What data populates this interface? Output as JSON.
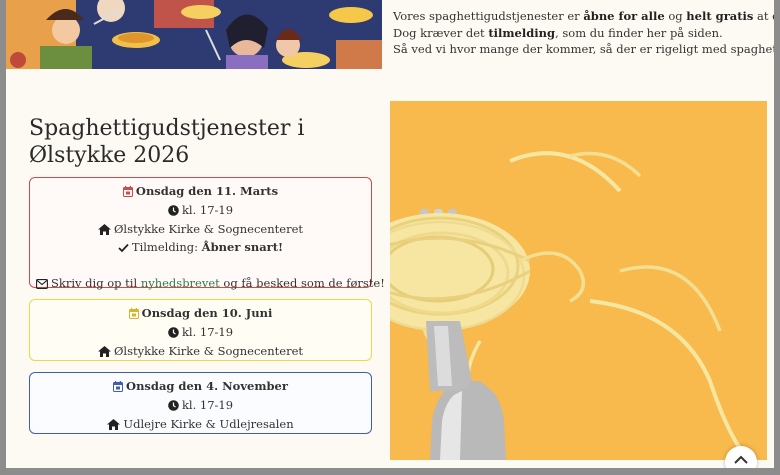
{
  "intro": {
    "line1_pre": "Vores spaghettigudstjenester er ",
    "line1_bold1": "åbne for alle",
    "line1_mid": " og ",
    "line1_bold2": "helt gratis",
    "line1_post": " at deltage i.",
    "line2_pre": "Dog kræver det ",
    "line2_bold": "tilmelding",
    "line2_post": ", som du finder her på siden.",
    "line3": "Så ved vi hvor mange der kommer, så der er rigeligt med spaghetti til alle."
  },
  "page_title": "Spaghettigudstjenester i Ølstykke 2026",
  "events": [
    {
      "date": "Onsdag den 11. Marts",
      "time": "kl. 17-19",
      "location": "Ølstykke Kirke & Sognecenteret",
      "signup_label": "Tilmelding: ",
      "signup_value": "Åbner snart!",
      "newsletter_pre": "Skriv dig op til ",
      "newsletter_link": "nyhedsbrevet",
      "newsletter_post": " og få besked som de første!",
      "accent": "#d04a4a"
    },
    {
      "date": "Onsdag den 10. Juni",
      "time": "kl. 17-19",
      "location": "Ølstykke Kirke & Sognecenteret",
      "accent": "#f1d64a"
    },
    {
      "date": "Onsdag den 4. November",
      "time": "kl. 17-19",
      "location": "Udlejre Kirke & Udlejresalen",
      "accent": "#3f5fae"
    }
  ],
  "icons": {
    "calendar": "calendar-icon",
    "clock": "clock-icon",
    "home": "home-icon",
    "check": "check-icon",
    "envelope": "envelope-icon",
    "scroll_top": "chevron-up-icon"
  },
  "colors": {
    "page_background": "#fdfaf3",
    "photo_background": "#f8b94d",
    "banner_background": "#2e3a72",
    "link": "#2f7a4a"
  }
}
